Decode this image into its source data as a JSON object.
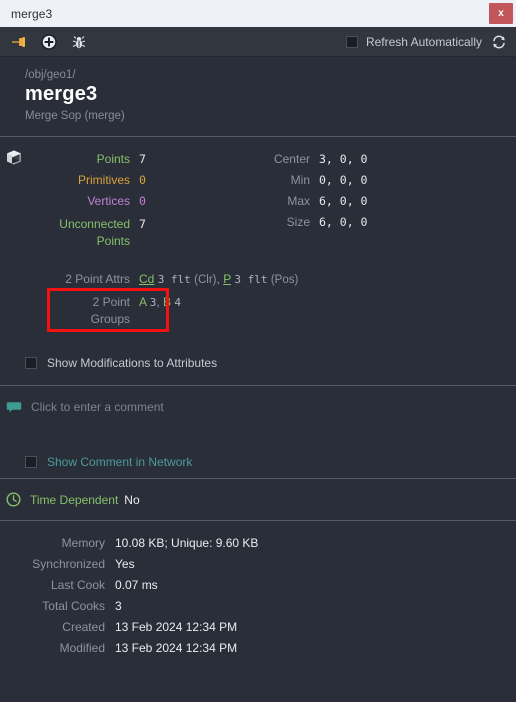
{
  "titlebar": {
    "title": "merge3",
    "close_label": "x",
    "close_icon": "close-icon"
  },
  "toolbar": {
    "pin_icon": "pushpin-icon",
    "add_icon": "plus-circle-icon",
    "bug_icon": "bug-icon",
    "refresh_checkbox_checked": false,
    "refresh_label": "Refresh Automatically",
    "refresh_icon": "refresh-icon"
  },
  "header": {
    "path": "/obj/geo1/",
    "title": "merge3",
    "subtitle": "Merge Sop (merge)"
  },
  "geometry": {
    "icon": "cube-icon",
    "left_stats": [
      {
        "label": "Points",
        "value": "7",
        "color": "#86c06a"
      },
      {
        "label": "Primitives",
        "value": "0",
        "color": "#d9a23c"
      },
      {
        "label": "Vertices",
        "value": "0",
        "color": "#c57fd6"
      },
      {
        "label": "Unconnected Points",
        "value": "7",
        "color": "#86c06a"
      }
    ],
    "right_stats": [
      {
        "label": "Center",
        "value": "3, 0, 0"
      },
      {
        "label": "Min",
        "value": "0, 0, 0"
      },
      {
        "label": "Max",
        "value": "6, 0, 0"
      },
      {
        "label": "Size",
        "value": "6, 0, 0"
      }
    ]
  },
  "attributes": {
    "label": "2 Point Attrs",
    "items": [
      {
        "name": "Cd",
        "type": "3 flt",
        "kind": "(Clr)"
      },
      {
        "name": "P",
        "type": "3 flt",
        "kind": "(Pos)"
      }
    ],
    "separator": ","
  },
  "groups": {
    "label_line1": "2 Point",
    "label_line2": "Groups",
    "items": [
      {
        "name": "A",
        "count": "3"
      },
      {
        "name": "B",
        "count": "4"
      }
    ],
    "separator": ",",
    "highlight_color": "#f51111"
  },
  "show_modifications": {
    "checked": false,
    "label": "Show Modifications to Attributes"
  },
  "comment": {
    "icon": "comment-bubble-icon",
    "placeholder": "Click to enter a comment",
    "value": "",
    "show_in_network_checked": false,
    "show_in_network_label": "Show Comment in Network"
  },
  "time_dependent": {
    "icon": "clock-icon",
    "label": "Time Dependent",
    "value": "No"
  },
  "info": [
    {
      "label": "Memory",
      "value": "10.08 KB; Unique: 9.60 KB"
    },
    {
      "label": "Synchronized",
      "value": "Yes"
    },
    {
      "label": "Last Cook",
      "value": "0.07 ms"
    },
    {
      "label": "Total Cooks",
      "value": "3"
    },
    {
      "label": "Created",
      "value": "13 Feb 2024 12:34 PM"
    },
    {
      "label": "Modified",
      "value": "13 Feb 2024 12:34 PM"
    }
  ]
}
